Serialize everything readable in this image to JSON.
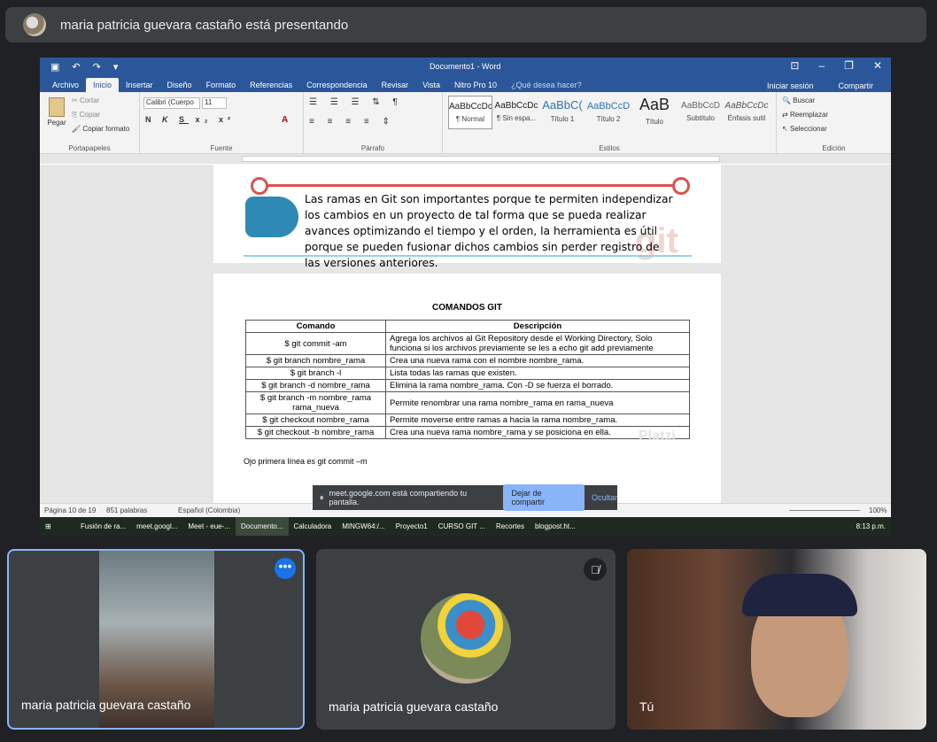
{
  "meet": {
    "presenting_banner": "maria patricia guevara castaño está presentando"
  },
  "word": {
    "window_title": "Documento1 - Word",
    "tabs": [
      "Archivo",
      "Inicio",
      "Insertar",
      "Diseño",
      "Formato",
      "Referencias",
      "Correspondencia",
      "Revisar",
      "Vista",
      "Nitro Pro 10"
    ],
    "tell_me": "¿Qué desea hacer?",
    "signin": "Iniciar sesión",
    "share": "Compartir",
    "clipboard": {
      "paste": "Pegar",
      "cut": "Cortar",
      "copy": "Copiar",
      "format_painter": "Copiar formato",
      "label": "Portapapeles"
    },
    "font": {
      "name": "Calibri (Cuerpo",
      "size": "11",
      "label": "Fuente"
    },
    "paragraph_label": "Párrafo",
    "styles": [
      {
        "sample": "AaBbCcDc",
        "name": "¶ Normal"
      },
      {
        "sample": "AaBbCcDc",
        "name": "¶ Sin espa..."
      },
      {
        "sample": "AaBbC(",
        "name": "Título 1"
      },
      {
        "sample": "AaBbCcD",
        "name": "Título 2"
      },
      {
        "sample": "AaB",
        "name": "Título"
      },
      {
        "sample": "AaBbCcD",
        "name": "Subtítulo"
      },
      {
        "sample": "AaBbCcDc",
        "name": "Énfasis sutil"
      }
    ],
    "styles_label": "Estilos",
    "editing": {
      "find": "Buscar",
      "replace": "Reemplazar",
      "select": "Seleccionar",
      "label": "Edición"
    },
    "paragraph_text": "Las ramas en Git son importantes porque te permiten independizar los cambios en un proyecto de tal forma que se pueda realizar avances optimizando el tiempo y el orden, la herramienta es útil porque se pueden fusionar dichos cambios sin perder registro de las versiones anteriores.",
    "watermark": "git",
    "section_title": "COMANDOS GIT",
    "table": {
      "headers": [
        "Comando",
        "Descripción"
      ],
      "rows": [
        [
          "$ git commit -am",
          "Agrega los archivos al Git Repository desde el Working Directory, Solo funciona si los archivos previamente se les a echo git add previamente"
        ],
        [
          "$ git branch nombre_rama",
          "Crea una nueva rama con el nombre nombre_rama."
        ],
        [
          "$ git branch -l",
          "Lista todas las ramas que existen."
        ],
        [
          "$ git branch -d nombre_rama",
          "Elimina la rama nombre_rama. Con -D se fuerza el borrado."
        ],
        [
          "$ git branch -m nombre_rama rama_nueva",
          "Permite renombrar una rama nombre_rama en rama_nueva"
        ],
        [
          "$ git checkout nombre_rama",
          "Permite moverse entre ramas a hacia la rama nombre_rama."
        ],
        [
          "$ git checkout -b nombre_rama",
          "Crea una nueva rama nombre_rama y se posiciona en ella."
        ]
      ]
    },
    "watermark2": "Platzi",
    "note": "Ojo primera línea es git commit –m",
    "status": {
      "page": "Página 10 de 19",
      "words": "851 palabras",
      "language": "Español (Colombia)",
      "zoom": "100%"
    }
  },
  "share_bar": {
    "text": "meet.google.com está compartiendo tu pantalla.",
    "stop": "Dejar de compartir",
    "hide": "Ocultar"
  },
  "taskbar": {
    "items": [
      "Fusión de ra...",
      "meet.googl...",
      "Meet - eue-...",
      "Documento...",
      "Calculadora",
      "MINGW64:/...",
      "Proyecto1",
      "CURSO GIT ...",
      "Recortes",
      "blogpost.ht..."
    ],
    "time": "8:13 p.m."
  },
  "participants": [
    {
      "name": "maria patricia guevara castaño"
    },
    {
      "name": "maria patricia guevara castaño"
    },
    {
      "name": "Tú"
    }
  ],
  "colors": {
    "word_blue": "#2b579a",
    "meet_bg": "#202124",
    "tile_bg": "#3c4043",
    "active_border": "#8ab4f8",
    "link_blue": "#2e75b6",
    "red": "#c00000",
    "cyan": "#1fa0d6"
  }
}
